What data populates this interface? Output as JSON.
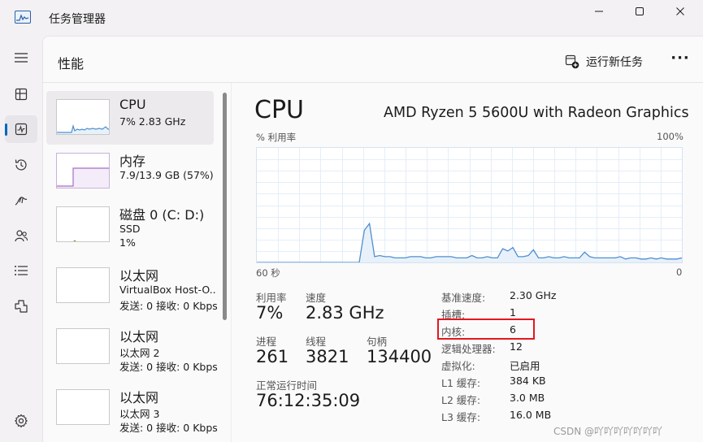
{
  "window": {
    "title": "任务管理器",
    "controls": [
      "minimize",
      "maximize",
      "close"
    ]
  },
  "nav": {
    "items": [
      {
        "icon": "hamburger-icon"
      },
      {
        "icon": "processes-icon"
      },
      {
        "icon": "performance-icon",
        "active": true
      },
      {
        "icon": "app-history-icon"
      },
      {
        "icon": "startup-icon"
      },
      {
        "icon": "users-icon"
      },
      {
        "icon": "details-icon"
      },
      {
        "icon": "services-icon"
      },
      {
        "icon": "settings-icon"
      }
    ]
  },
  "header": {
    "title": "性能",
    "run_task_label": "运行新任务",
    "more_label": "···"
  },
  "resources": [
    {
      "name": "CPU",
      "line1": "7%  2.83 GHz",
      "line2": "",
      "selected": true
    },
    {
      "name": "内存",
      "line1": "7.9/13.9 GB (57%)",
      "line2": ""
    },
    {
      "name": "磁盘 0 (C: D:)",
      "line1": "SSD",
      "line2": "1%"
    },
    {
      "name": "以太网",
      "line1": "VirtualBox Host-O...",
      "line2": "发送: 0 接收: 0 Kbps"
    },
    {
      "name": "以太网",
      "line1": "以太网 2",
      "line2": "发送: 0 接收: 0 Kbps"
    },
    {
      "name": "以太网",
      "line1": "以太网 3",
      "line2": "发送: 0 接收: 0 Kbps"
    }
  ],
  "detail": {
    "title": "CPU",
    "model": "AMD Ryzen 5 5600U with Radeon Graphics",
    "graph": {
      "ylabel": "% 利用率",
      "ymax_label": "100%",
      "xlabel": "60 秒",
      "xmin_label": "0",
      "usage_history": [
        0,
        0,
        0,
        0,
        0,
        0,
        0,
        0,
        0,
        0,
        0,
        0,
        0,
        0,
        0,
        0,
        0,
        0,
        0,
        0,
        0,
        28,
        34,
        5,
        6,
        5,
        5,
        4,
        4,
        4,
        5,
        5,
        5,
        4,
        4,
        5,
        5,
        5,
        5,
        4,
        4,
        4,
        6,
        4,
        4,
        5,
        4,
        4,
        12,
        10,
        13,
        5,
        5,
        6,
        11,
        4,
        4,
        5,
        4,
        4,
        5,
        4,
        4,
        4,
        9,
        5,
        4,
        4,
        4,
        4,
        4,
        5,
        3,
        4,
        4,
        3,
        3,
        4,
        3,
        4,
        3,
        3,
        3,
        4
      ]
    },
    "stats": {
      "utilization_label": "利用率",
      "utilization_value": "7%",
      "speed_label": "速度",
      "speed_value": "2.83 GHz",
      "processes_label": "进程",
      "processes_value": "261",
      "threads_label": "线程",
      "threads_value": "3821",
      "handles_label": "句柄",
      "handles_value": "134400",
      "uptime_label": "正常运行时间",
      "uptime_value": "76:12:35:09"
    },
    "specs": [
      {
        "k": "基准速度:",
        "v": "2.30 GHz"
      },
      {
        "k": "插槽:",
        "v": "1"
      },
      {
        "k": "内核:",
        "v": "6"
      },
      {
        "k": "逻辑处理器:",
        "v": "12"
      },
      {
        "k": "虚拟化:",
        "v": "已启用"
      },
      {
        "k": "L1 缓存:",
        "v": "384 KB"
      },
      {
        "k": "L2 缓存:",
        "v": "3.0 MB"
      },
      {
        "k": "L3 缓存:",
        "v": "16.0 MB"
      }
    ]
  },
  "colors": {
    "accent": "#0067c0",
    "cpu_line": "#4f8fd1",
    "cpu_fill": "#e8f1fa",
    "memory_line": "#a66fc6",
    "highlight": "#e2181f"
  },
  "watermark": "CSDN @吖吖吖吖吖吖吖"
}
